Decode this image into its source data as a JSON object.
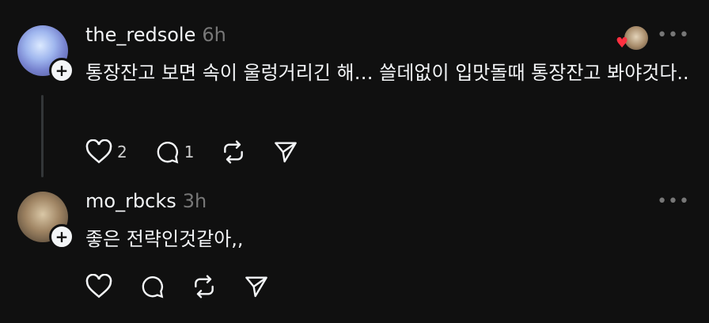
{
  "posts": [
    {
      "username": "the_redsole",
      "time": "6h",
      "text": "통장잔고 보면 속이 울렁거리긴 해… 쓸데없이 입맛돌때 통장잔고 봐야것다..",
      "like_count": "2",
      "reply_count": "1",
      "more_label": "•••"
    },
    {
      "username": "mo_rbcks",
      "time": "3h",
      "text": "좋은 전략인것같아,,",
      "like_count": "",
      "reply_count": "",
      "more_label": "•••"
    }
  ],
  "icons": {
    "like": "heart-icon",
    "reply": "comment-icon",
    "repost": "repost-icon",
    "share": "send-icon",
    "follow": "plus-icon"
  },
  "colors": {
    "background": "#101010",
    "text": "#f3f5f7",
    "muted": "#777777",
    "heart": "#ff3040"
  }
}
